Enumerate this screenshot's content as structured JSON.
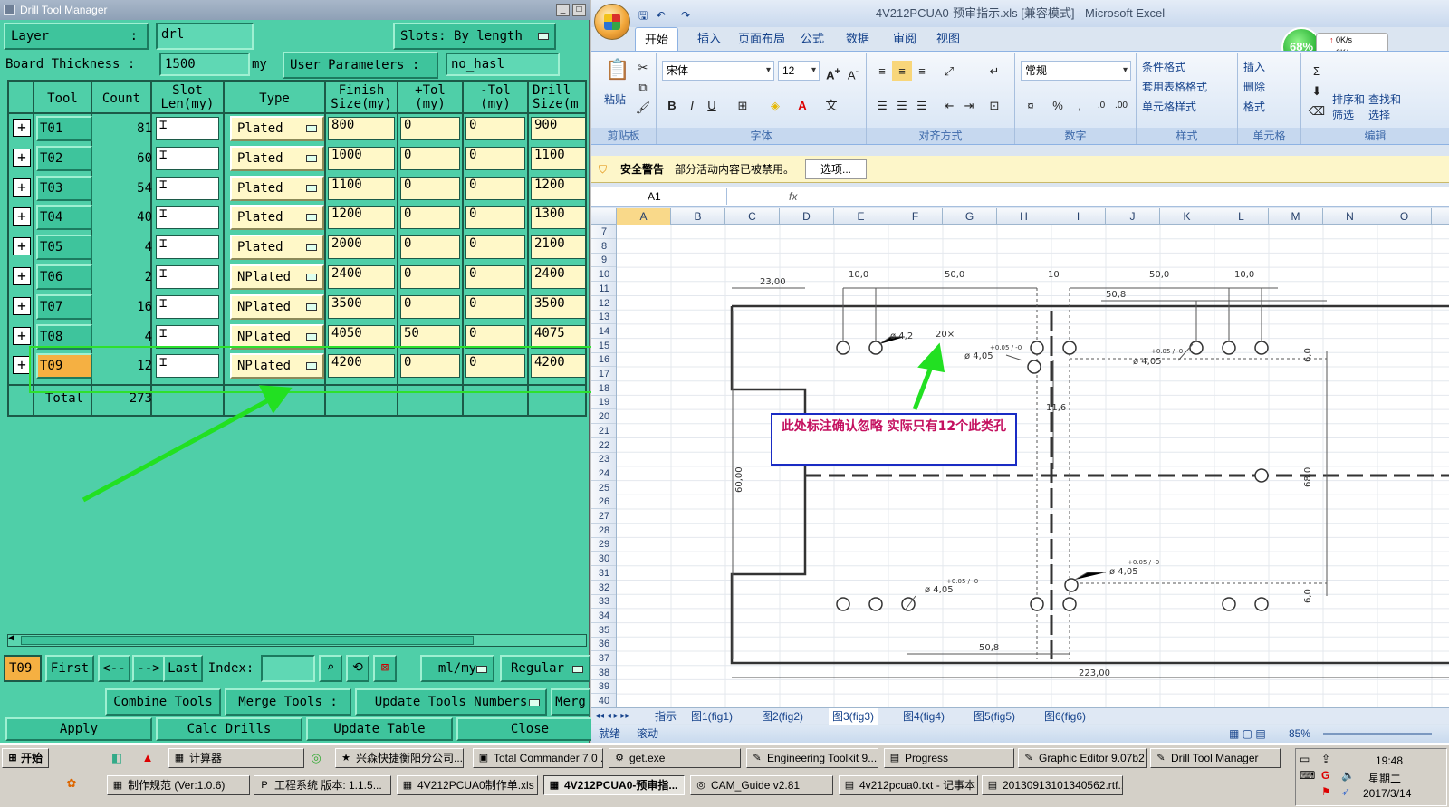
{
  "dtm": {
    "title": "Drill Tool Manager",
    "layer_label": "Layer",
    "layer_colon": ":",
    "layer_value": "drl",
    "slots_label": "Slots:",
    "slots_value": "By length",
    "board_thickness_label": "Board Thickness :",
    "board_thickness_value": "1500",
    "board_thickness_unit": "my",
    "user_params_label": "User Parameters :",
    "user_params_value": "no_hasl",
    "columns": [
      "Tool",
      "Count",
      "Slot\nLen(my)",
      "Type",
      "Finish\nSize(my)",
      "+Tol\n(my)",
      "-Tol\n(my)",
      "Drill\nSize(m"
    ],
    "rows": [
      {
        "tool": "T01",
        "count": "81",
        "type": "Plated",
        "finish": "800",
        "ptol": "0",
        "ntol": "0",
        "drill": "900"
      },
      {
        "tool": "T02",
        "count": "60",
        "type": "Plated",
        "finish": "1000",
        "ptol": "0",
        "ntol": "0",
        "drill": "1100"
      },
      {
        "tool": "T03",
        "count": "54",
        "type": "Plated",
        "finish": "1100",
        "ptol": "0",
        "ntol": "0",
        "drill": "1200"
      },
      {
        "tool": "T04",
        "count": "40",
        "type": "Plated",
        "finish": "1200",
        "ptol": "0",
        "ntol": "0",
        "drill": "1300"
      },
      {
        "tool": "T05",
        "count": "4",
        "type": "Plated",
        "finish": "2000",
        "ptol": "0",
        "ntol": "0",
        "drill": "2100"
      },
      {
        "tool": "T06",
        "count": "2",
        "type": "NPlated",
        "finish": "2400",
        "ptol": "0",
        "ntol": "0",
        "drill": "2400"
      },
      {
        "tool": "T07",
        "count": "16",
        "type": "NPlated",
        "finish": "3500",
        "ptol": "0",
        "ntol": "0",
        "drill": "3500"
      },
      {
        "tool": "T08",
        "count": "4",
        "type": "NPlated",
        "finish": "4050",
        "ptol": "50",
        "ntol": "0",
        "drill": "4075"
      },
      {
        "tool": "T09",
        "count": "12",
        "type": "NPlated",
        "finish": "4200",
        "ptol": "0",
        "ntol": "0",
        "drill": "4200"
      }
    ],
    "total_label": "Total",
    "total_value": "273",
    "current_tool": "T09",
    "nav": {
      "first": "First",
      "prev": "<--",
      "next": "-->",
      "last": "Last",
      "index_label": "Index:",
      "units": "ml/my",
      "mode": "Regular"
    },
    "buttons": {
      "combine": "Combine Tools",
      "merge": "Merge Tools :",
      "update_numbers": "Update Tools Numbers",
      "merge_trunc": "Merg",
      "apply": "Apply",
      "calc": "Calc Drills",
      "update_table": "Update Table",
      "close": "Close"
    }
  },
  "excel": {
    "title": "4V212PCUA0-预审指示.xls  [兼容模式] - Microsoft Excel",
    "tabs": [
      "开始",
      "插入",
      "页面布局",
      "公式",
      "数据",
      "审阅",
      "视图"
    ],
    "groups": {
      "clipboard": "剪贴板",
      "font": "字体",
      "alignment": "对齐方式",
      "number": "数字",
      "styles": "样式",
      "cells": "单元格",
      "editing": "编辑"
    },
    "paste": "粘贴",
    "font_name": "宋体",
    "font_size": "12",
    "number_format": "常规",
    "styles_items": [
      "条件格式",
      "套用表格格式",
      "单元格样式"
    ],
    "cells_items": [
      "插入",
      "删除",
      "格式"
    ],
    "editing_items": [
      "排序和",
      "筛选",
      "查找和",
      "选择"
    ],
    "security_title": "安全警告",
    "security_msg": "部分活动内容已被禁用。",
    "security_btn": "选项...",
    "name_box": "A1",
    "fx": "fx",
    "col_headers": [
      "A",
      "B",
      "C",
      "D",
      "E",
      "F",
      "G",
      "H",
      "I",
      "J",
      "K",
      "L",
      "M",
      "N",
      "O"
    ],
    "row_headers": [
      "7",
      "8",
      "9",
      "10",
      "11",
      "12",
      "13",
      "14",
      "15",
      "16",
      "17",
      "18",
      "19",
      "20",
      "21",
      "22",
      "23",
      "24",
      "25",
      "26",
      "27",
      "28",
      "29",
      "30",
      "31",
      "32",
      "33",
      "34",
      "35",
      "36",
      "37",
      "38",
      "39",
      "40"
    ],
    "note": "此处标注确认忽略   实际只有12个此类孔",
    "dims": {
      "d23": "23,00",
      "d10a": "10,0",
      "d50a": "50,0",
      "d10b": "10",
      "d50b": "50,0",
      "d10c": "10,0",
      "d508a": "50,8",
      "phi42": "ø 4,2",
      "x20": "20×",
      "tol1": "+0.05 / -0",
      "phi405a": "ø 4,05",
      "tol2": "+0.05 / -0",
      "phi405b": "ø 4,05",
      "d116": "11,6",
      "d60": "6,0",
      "d6000": "60,00",
      "d680": "68,0",
      "tol3": "+0.05 / -0",
      "phi405c": "ø 4,05",
      "tol4": "+0.05 / -0",
      "phi405d": "ø 4,05",
      "d60b": "6,0",
      "d508b": "50,8",
      "d223": "223,00"
    },
    "sheet_tabs": [
      "指示",
      "图1(fig1)",
      "图2(fig2)",
      "图3(fig3)",
      "图4(fig4)",
      "图5(fig5)",
      "图6(fig6)"
    ],
    "active_sheet": "图3(fig3)",
    "status_ready": "就绪",
    "status_scroll": "滚动",
    "zoom": "85%",
    "net_percent": "68%",
    "net_up": "0K/s",
    "net_down": "0K/s"
  },
  "taskbar": {
    "start": "开始",
    "row1": [
      "计算器",
      "兴森快捷衡阳分公司...",
      "Total Commander 7.0 ...",
      "get.exe",
      "Engineering Toolkit 9....",
      "Progress",
      "Graphic Editor 9.07b2 ...",
      "Drill Tool Manager"
    ],
    "row2": [
      "制作规范 (Ver:1.0.6)",
      "工程系统  版本: 1.1.5...",
      "4V212PCUA0制作单.xls ...",
      "4V212PCUA0-预审指...",
      "CAM_Guide v2.81",
      "4v212pcua0.txt - 记事本",
      "20130913101340562.rtf..."
    ],
    "time": "19:48",
    "weekday": "星期二",
    "date": "2017/3/14"
  },
  "colors": {
    "dtm_bg": "#4fcfa8",
    "highlight_box": "#2ee02e",
    "arrow": "#22e022",
    "note_text": "#c4105f",
    "note_border": "#1a2cc4",
    "selected_tool": "#f5b042"
  }
}
